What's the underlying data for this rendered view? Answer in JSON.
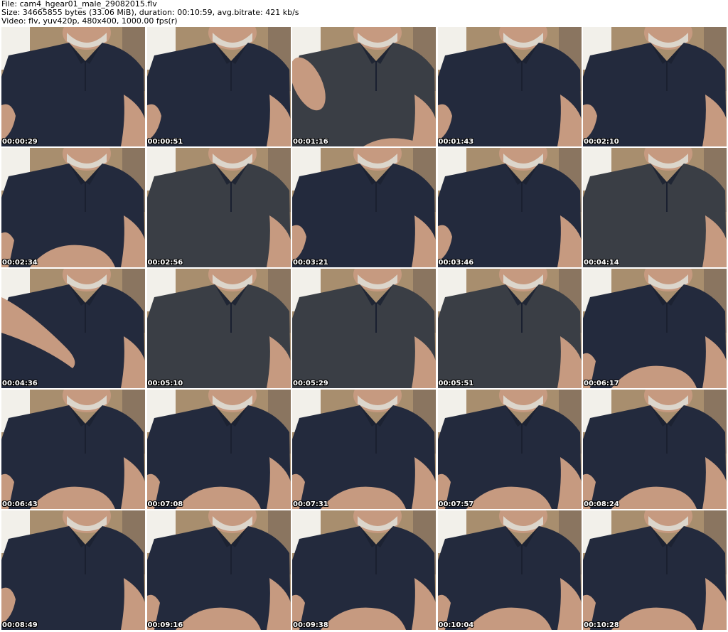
{
  "header": {
    "file_line": "File: cam4_hgear01_male_29082015.flv",
    "size_line": "Size: 34665855 bytes (33.06 MiB), duration: 00:10:59, avg.bitrate: 421 kb/s",
    "video_line": "Video: flv, yuv420p, 480x400, 1000.00 fps(r)"
  },
  "colors": {
    "shirt_navy": "#232a3d",
    "shirt_gray": "#3a3e45",
    "wall": "#a88e6e",
    "window": "#f2f0ea",
    "skin": "#c69a80",
    "hair": "#dcd6cc"
  },
  "thumbnails": [
    {
      "time": "00:00:29",
      "shirt": "navy",
      "arm": "left"
    },
    {
      "time": "00:00:51",
      "shirt": "navy",
      "arm": "left"
    },
    {
      "time": "00:01:16",
      "shirt": "gray",
      "arm": "hand"
    },
    {
      "time": "00:01:43",
      "shirt": "navy",
      "arm": "left"
    },
    {
      "time": "00:02:10",
      "shirt": "navy",
      "arm": "left"
    },
    {
      "time": "00:02:34",
      "shirt": "navy",
      "arm": "hands"
    },
    {
      "time": "00:02:56",
      "shirt": "gray",
      "arm": "none"
    },
    {
      "time": "00:03:21",
      "shirt": "navy",
      "arm": "left"
    },
    {
      "time": "00:03:46",
      "shirt": "navy",
      "arm": "left"
    },
    {
      "time": "00:04:14",
      "shirt": "gray",
      "arm": "none"
    },
    {
      "time": "00:04:36",
      "shirt": "navy",
      "arm": "cross"
    },
    {
      "time": "00:05:10",
      "shirt": "gray",
      "arm": "none"
    },
    {
      "time": "00:05:29",
      "shirt": "gray",
      "arm": "none"
    },
    {
      "time": "00:05:51",
      "shirt": "gray",
      "arm": "none"
    },
    {
      "time": "00:06:17",
      "shirt": "navy",
      "arm": "hands"
    },
    {
      "time": "00:06:43",
      "shirt": "navy",
      "arm": "hands"
    },
    {
      "time": "00:07:08",
      "shirt": "navy",
      "arm": "hands"
    },
    {
      "time": "00:07:31",
      "shirt": "navy",
      "arm": "hands"
    },
    {
      "time": "00:07:57",
      "shirt": "navy",
      "arm": "hands"
    },
    {
      "time": "00:08:24",
      "shirt": "navy",
      "arm": "hands"
    },
    {
      "time": "00:08:49",
      "shirt": "navy",
      "arm": "left"
    },
    {
      "time": "00:09:16",
      "shirt": "navy",
      "arm": "hands"
    },
    {
      "time": "00:09:38",
      "shirt": "navy",
      "arm": "hands"
    },
    {
      "time": "00:10:04",
      "shirt": "navy",
      "arm": "hands"
    },
    {
      "time": "00:10:28",
      "shirt": "navy",
      "arm": "hands"
    }
  ]
}
